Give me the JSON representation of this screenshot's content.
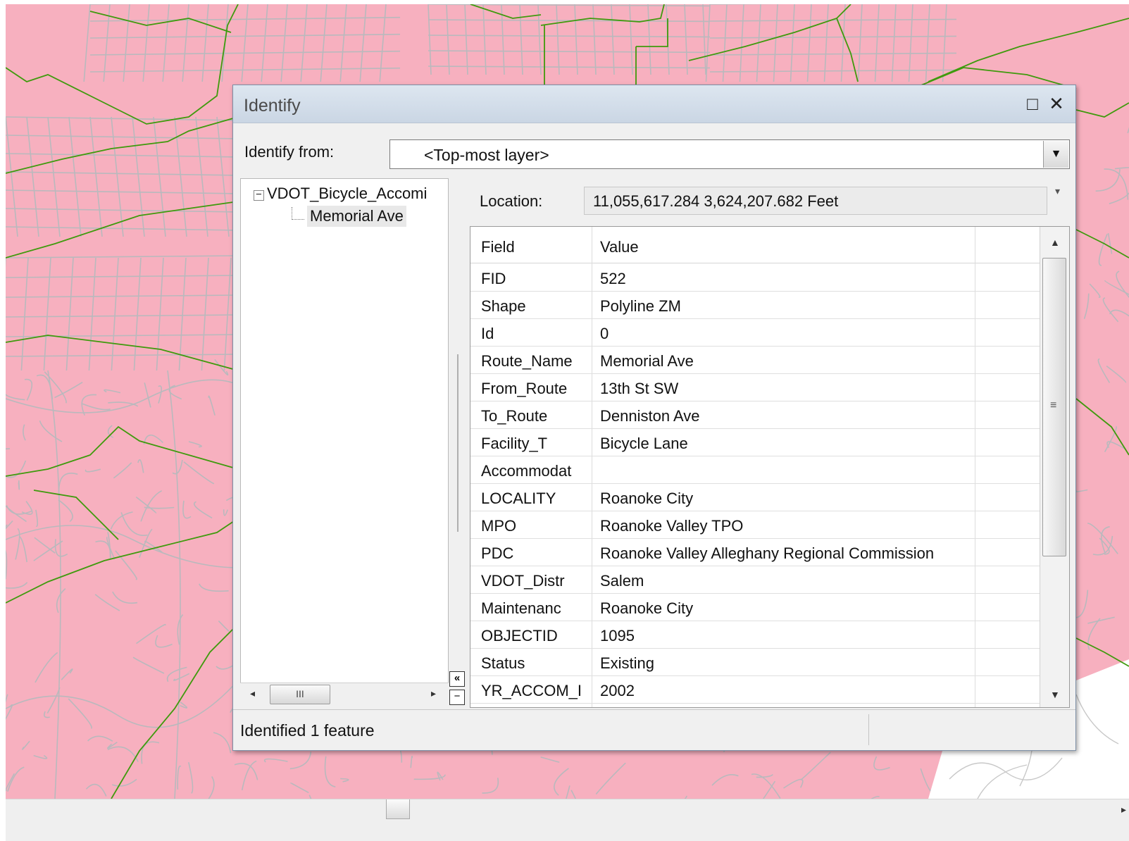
{
  "window": {
    "title": "Identify",
    "maximize_icon": "□",
    "close_icon": "✕"
  },
  "identify_from": {
    "label": "Identify from:",
    "value": "<Top-most layer>"
  },
  "tree": {
    "root_label": "VDOT_Bicycle_Accomi",
    "child_label": "Memorial Ave"
  },
  "location": {
    "label": "Location:",
    "value": "11,055,617.284  3,624,207.682 Feet"
  },
  "grid": {
    "columns": [
      "Field",
      "Value"
    ],
    "rows": [
      {
        "field": "FID",
        "value": "522"
      },
      {
        "field": "Shape",
        "value": "Polyline ZM"
      },
      {
        "field": "Id",
        "value": "0"
      },
      {
        "field": "Route_Name",
        "value": "Memorial Ave"
      },
      {
        "field": "From_Route",
        "value": "13th St SW"
      },
      {
        "field": "To_Route",
        "value": "Denniston Ave"
      },
      {
        "field": "Facility_T",
        "value": "Bicycle Lane"
      },
      {
        "field": "Accommodat",
        "value": ""
      },
      {
        "field": "LOCALITY",
        "value": "Roanoke City"
      },
      {
        "field": "MPO",
        "value": "Roanoke Valley TPO"
      },
      {
        "field": "PDC",
        "value": "Roanoke Valley Alleghany Regional Commission"
      },
      {
        "field": "VDOT_Distr",
        "value": "Salem"
      },
      {
        "field": "Maintenanc",
        "value": "Roanoke City"
      },
      {
        "field": "OBJECTID",
        "value": "1095"
      },
      {
        "field": "Status",
        "value": "Existing"
      },
      {
        "field": "YR_ACCOM_I",
        "value": "2002"
      }
    ]
  },
  "status": {
    "text": "Identified 1 feature"
  },
  "colors": {
    "map_background": "#f7b0bf",
    "road": "#b9b9bd",
    "bike_route": "#3f9a0d"
  }
}
